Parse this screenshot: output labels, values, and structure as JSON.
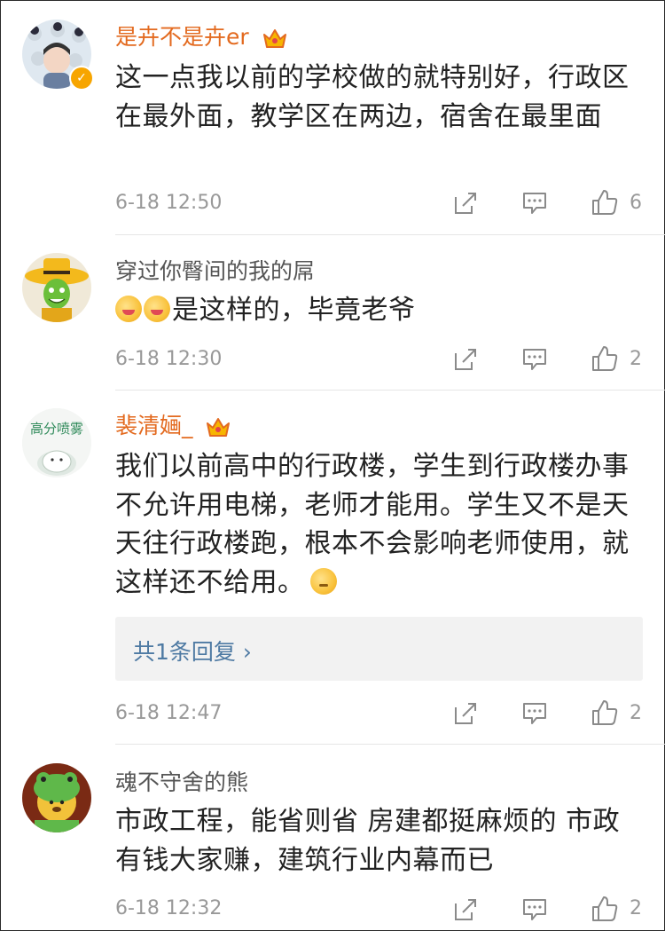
{
  "comments": [
    {
      "username": "是卉不是卉er",
      "vip": true,
      "text": "这一点我以前的学校做的就特别好，行政区在最外面，教学区在两边，宿舍在最里面",
      "time": "6-18 12:50",
      "likes": "6"
    },
    {
      "username": "穿过你臀间的我的屌",
      "vip": false,
      "text": "是这样的，毕竟老爷",
      "emoji_prefix": [
        "smile-emoji",
        "smile-emoji"
      ],
      "time": "6-18 12:30",
      "likes": "2"
    },
    {
      "username": "裴清婳_",
      "vip": true,
      "avatar_text": "高分喷雾",
      "text": "我们以前高中的行政楼，学生到行政楼办事不允许用电梯，老师才能用。学生又不是天天往行政楼跑，根本不会影响老师使用，就这样还不给用。",
      "emoji_suffix": "thinking-emoji",
      "reply_label": "共1条回复",
      "time": "6-18 12:47",
      "likes": "2"
    },
    {
      "username": "魂不守舍的熊",
      "vip": false,
      "text": "市政工程，能省则省 房建都挺麻烦的 市政 有钱大家赚，建筑行业内幕而已",
      "time": "6-18 12:32",
      "likes": "2"
    }
  ],
  "colors": {
    "vip_name": "#e36a1f",
    "normal_name": "#555555",
    "reply_link": "#4e7aa3",
    "meta": "#999999"
  },
  "icons": [
    "share-icon",
    "comment-icon",
    "like-icon",
    "crown-icon",
    "verified-badge"
  ]
}
